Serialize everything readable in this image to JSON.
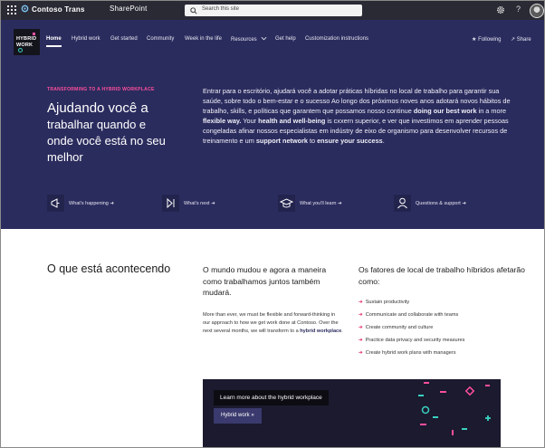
{
  "suite": {
    "brand": "Contoso Trans",
    "app": "SharePoint",
    "search_placeholder": "Search this site",
    "help": "?"
  },
  "colors": {
    "suitebar": "#2a2a35",
    "hero": "#2b2c5e",
    "accent_pink": "#ff4f9d",
    "accent_teal": "#3ad1c0",
    "banner": "#1b1a2e"
  },
  "site": {
    "logo_line1": "HYBRID",
    "logo_line2": "WORK"
  },
  "nav": {
    "items": [
      "Home",
      "Hybrid work",
      "Get started",
      "Community",
      "Week in the life",
      "Resources",
      "Get help",
      "Customization instructions"
    ],
    "follow": "Following",
    "share": "Share"
  },
  "hero": {
    "eyebrow": "TRANSFORMING TO A HYBRID WORKPLACE",
    "title_l1": "Ajudando você a",
    "title_l2": "trabalhar quando e",
    "title_l3": "onde você está no seu melhor",
    "body": {
      "p1": "Entrar para o escritório, ajudará você a adotar práticas híbridas no local de trabalho para garantir sua saúde, sobre todo o bem-estar e o sucesso Ao longo dos próximos noves anos adotará novos hábitos de trabalho, skills, e políticas que garantem que possamos nosso continue ",
      "b1": "doing our best work",
      "p2": " in a more ",
      "b2": "flexible way.",
      "p3": " Your ",
      "b3": "health and well-being",
      "p4": " is cxxern superior, e ver que investimos em aprender pessoas congeladas afinar nossos especialistas em indústry de eixo de organismo para desenvolver recursos de treinamento e um ",
      "b4": "support network",
      "p5": " to ",
      "b5": "ensure your success",
      "p6": "."
    },
    "quick_links": [
      "What's happening ➜",
      "What's next ➜",
      "What you'll learn ➜",
      "Questions & support ➜"
    ]
  },
  "main": {
    "section_title": "O que está acontecendo",
    "mid_heading": "O mundo mudou e agora a maneira como trabalhamos juntos também mudará.",
    "mid_body_pre": "More than ever, we must be flexible and forward-thinking in our approach to how we get work done at Contoso. Over the next several months, we will transform to a ",
    "mid_body_link": "hybrid workplace",
    "mid_body_post": ".",
    "right_heading": "Os fatores de local de trabalho híbridos afetarão como:",
    "bullet_arrow": "➜",
    "bullets": [
      "Sustain productivity",
      "Communicate and collaborate with teams",
      "Create community and culture",
      "Practice data privacy and security measures",
      "Create hybrid work plans with managers"
    ]
  },
  "banner": {
    "heading": "Learn more about the hybrid workplace",
    "button": "Hybrid work »"
  }
}
